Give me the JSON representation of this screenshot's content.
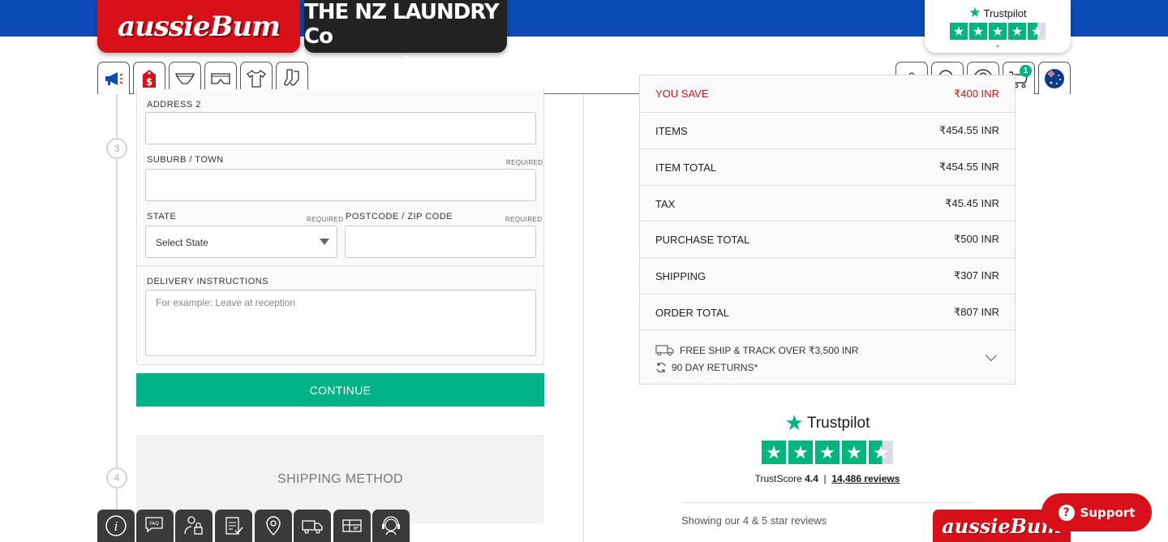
{
  "header": {
    "brand_aussie": "aussieBum",
    "brand_laundry": "THE NZ LAUNDRY Co",
    "trustpilot_name": "Trustpilot",
    "cart_count": "1"
  },
  "form": {
    "address2_label": "ADDRESS 2",
    "suburb_label": "SUBURB / TOWN",
    "state_label": "STATE",
    "postcode_label": "POSTCODE / ZIP CODE",
    "required_text": "REQUIRED",
    "state_select_value": "Select State",
    "delivery_label": "DELIVERY INSTRUCTIONS",
    "delivery_placeholder": "For example: Leave at reception",
    "continue_label": "CONTINUE",
    "step3": "3",
    "step4": "4",
    "shipping_method_label": "SHIPPING METHOD"
  },
  "summary": {
    "you_save_label": "YOU SAVE",
    "you_save_value": "₹400 INR",
    "rows": [
      {
        "label": "ITEMS",
        "value": "₹454.55 INR"
      },
      {
        "label": "ITEM TOTAL",
        "value": "₹454.55 INR"
      },
      {
        "label": "TAX",
        "value": "₹45.45 INR"
      },
      {
        "label": "PURCHASE TOTAL",
        "value": "₹500 INR"
      },
      {
        "label": "SHIPPING",
        "value": "₹307 INR"
      },
      {
        "label": "ORDER TOTAL",
        "value": "₹807 INR"
      }
    ],
    "free_ship": "FREE SHIP & TRACK OVER ₹3,500 INR",
    "returns": "90 DAY RETURNS*"
  },
  "trustpilot_widget": {
    "name": "Trustpilot",
    "trustscore_label": "TrustScore",
    "trustscore_value": "4.4",
    "reviews": "14,486 reviews",
    "showing": "Showing our 4 & 5 star reviews"
  },
  "bottom": {
    "aussie_logo": "aussieBum",
    "support_label": "Support"
  },
  "colors": {
    "accent_green": "#00b386",
    "brand_red": "#d8101a",
    "top_blue": "#0b4bb5",
    "trustpilot_green": "#00b67a"
  }
}
